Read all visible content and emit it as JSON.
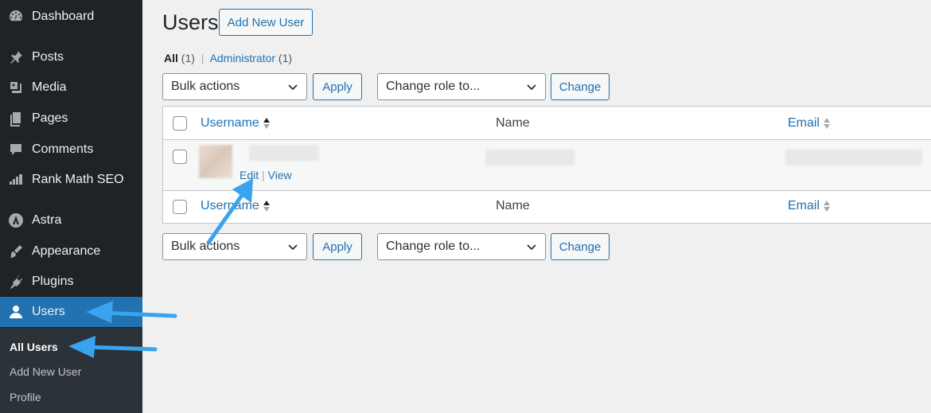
{
  "sidebar": {
    "items": [
      {
        "label": "Dashboard",
        "icon": "dashboard-icon"
      },
      {
        "label": "Posts",
        "icon": "pin-icon"
      },
      {
        "label": "Media",
        "icon": "media-icon"
      },
      {
        "label": "Pages",
        "icon": "pages-icon"
      },
      {
        "label": "Comments",
        "icon": "comment-icon"
      },
      {
        "label": "Rank Math SEO",
        "icon": "rank-math-icon"
      },
      {
        "label": "Astra",
        "icon": "astra-icon"
      },
      {
        "label": "Appearance",
        "icon": "brush-icon"
      },
      {
        "label": "Plugins",
        "icon": "plugin-icon"
      },
      {
        "label": "Users",
        "icon": "user-icon",
        "active": true
      }
    ],
    "submenu": [
      {
        "label": "All Users",
        "current": true
      },
      {
        "label": "Add New User"
      },
      {
        "label": "Profile"
      }
    ]
  },
  "page": {
    "title": "Users",
    "add_new_label": "Add New User"
  },
  "filters": {
    "all_label": "All",
    "all_count": "(1)",
    "admin_label": "Administrator",
    "admin_count": "(1)",
    "separator": "|"
  },
  "top_actions": {
    "bulk_select": "Bulk actions",
    "apply_label": "Apply",
    "role_select": "Change role to...",
    "change_label": "Change"
  },
  "bottom_actions": {
    "bulk_select": "Bulk actions",
    "apply_label": "Apply",
    "role_select": "Change role to...",
    "change_label": "Change"
  },
  "table": {
    "columns": {
      "username": "Username",
      "name": "Name",
      "email": "Email"
    },
    "row_actions": {
      "edit": "Edit",
      "separator": "|",
      "view": "View"
    }
  },
  "colors": {
    "sidebar_bg": "#1d2327",
    "accent": "#2271b1",
    "annotation_arrow": "#3aa3f0"
  }
}
